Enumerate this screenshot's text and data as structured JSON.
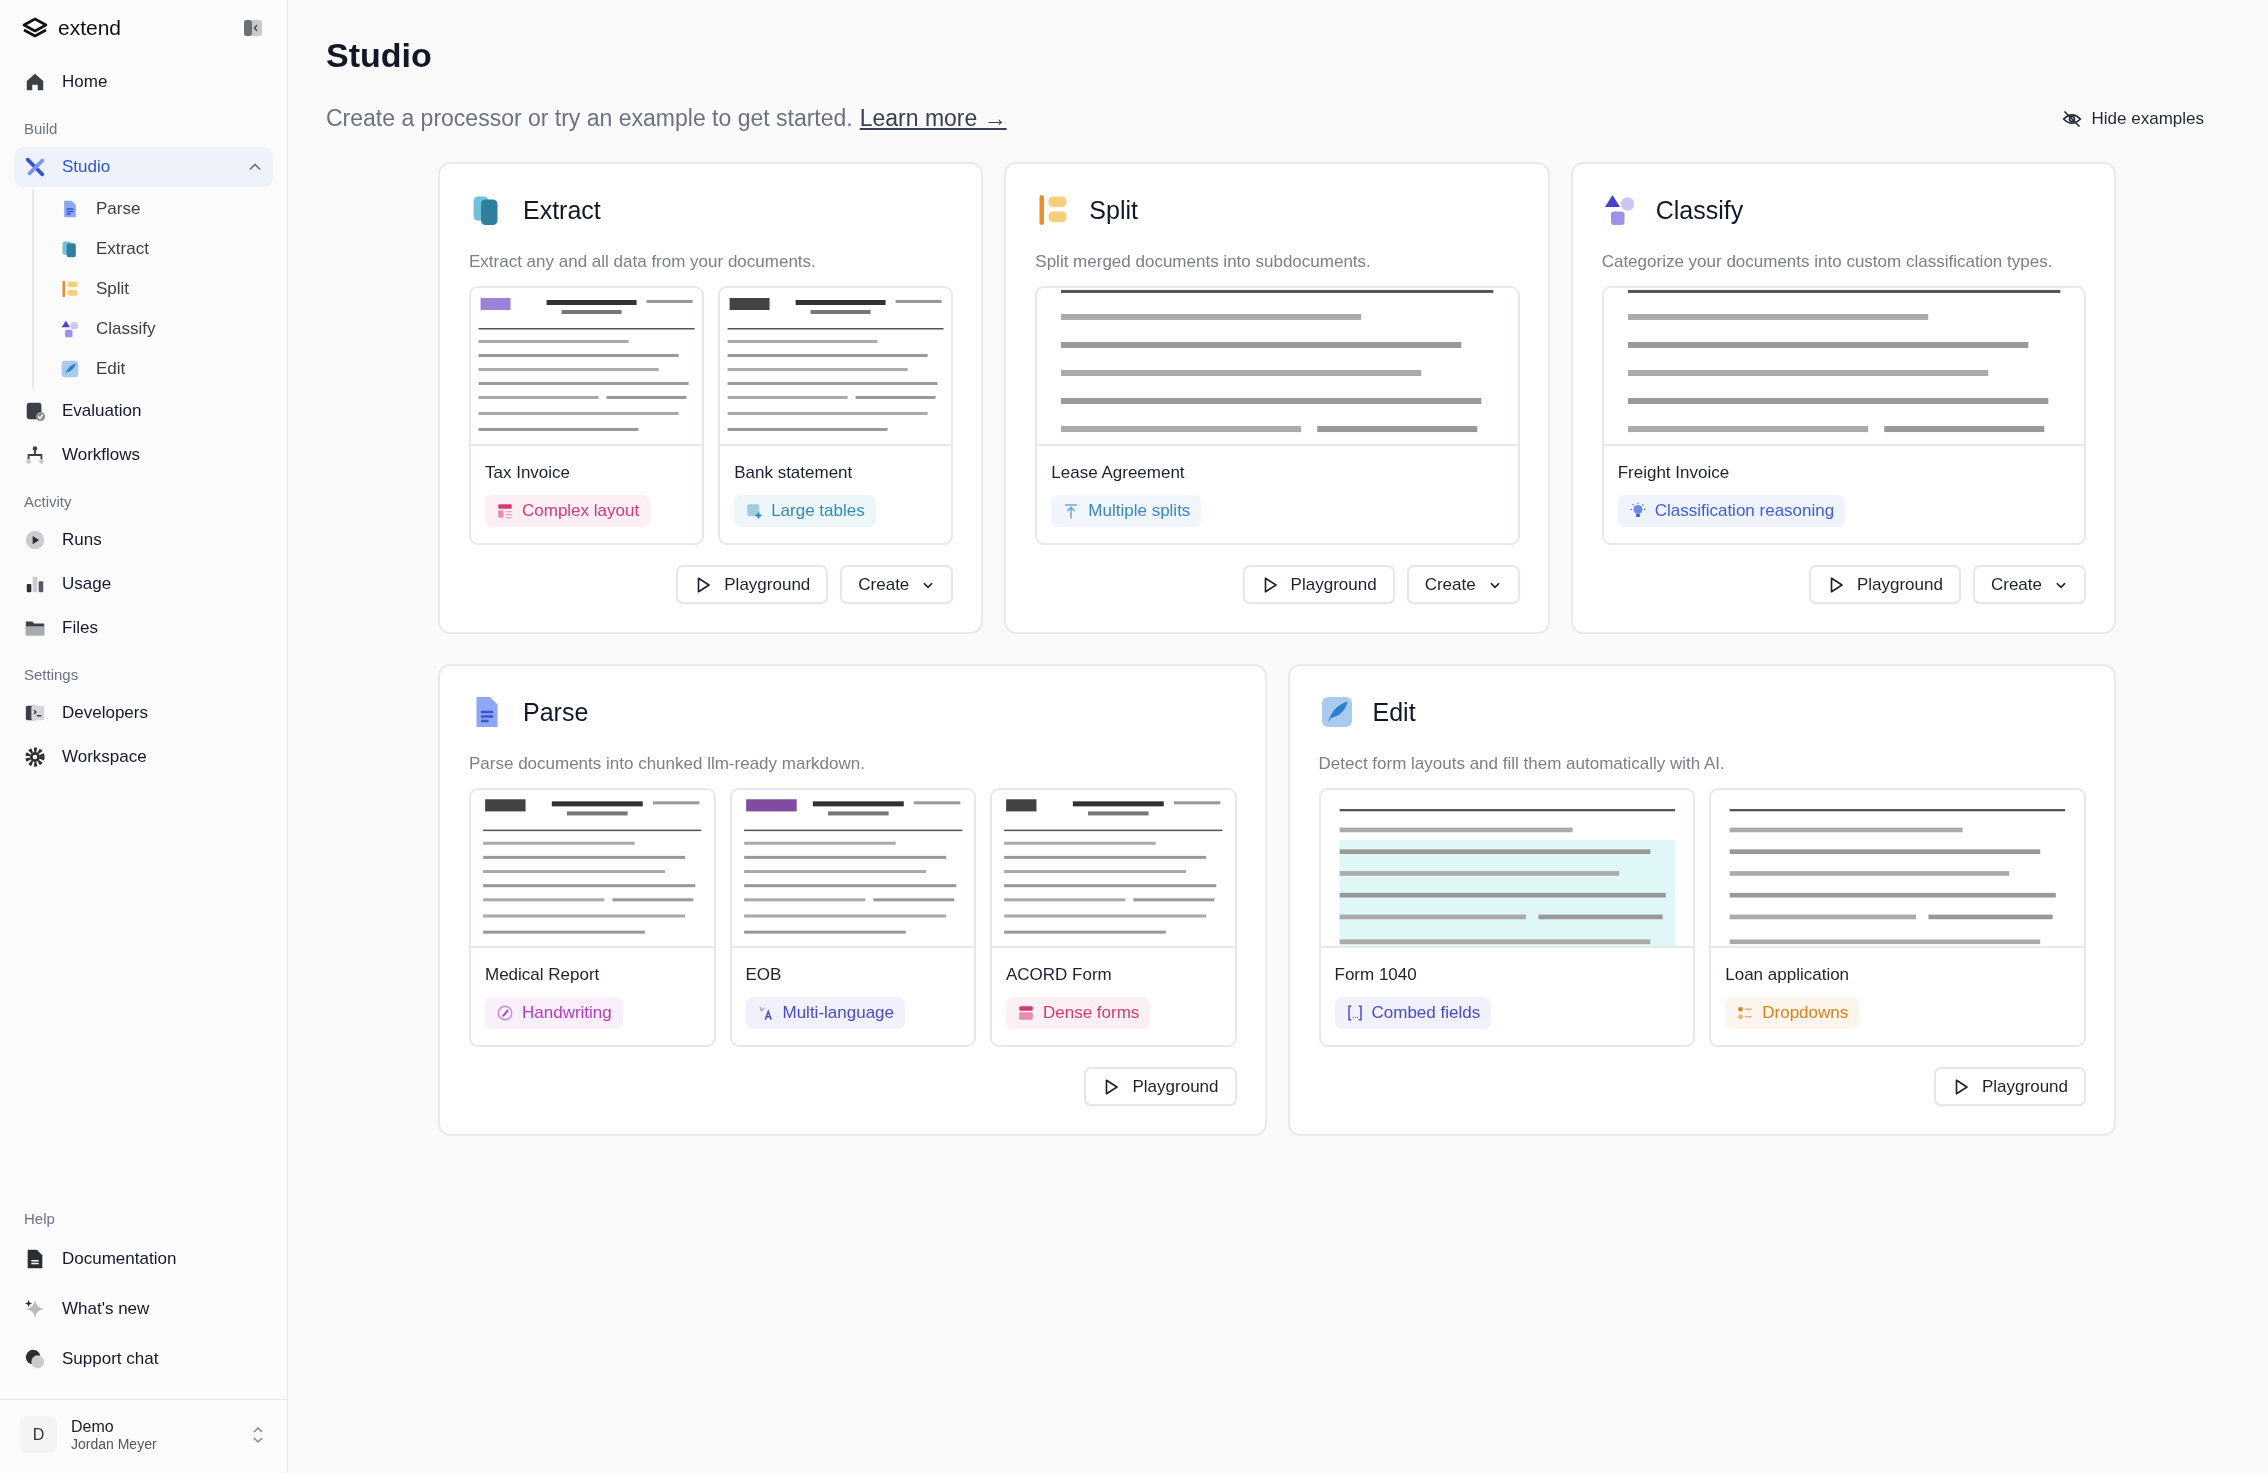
{
  "sidebar": {
    "brand": "extend",
    "sections": [
      {
        "items": [
          {
            "label": "Home",
            "selected": false
          }
        ]
      },
      {
        "label": "Build",
        "items": [
          {
            "label": "Studio",
            "selected": true,
            "expanded": true,
            "children": [
              {
                "label": "Parse",
                "selected": false
              },
              {
                "label": "Extract",
                "selected": false
              },
              {
                "label": "Split",
                "selected": false
              },
              {
                "label": "Classify",
                "selected": false
              },
              {
                "label": "Edit",
                "selected": false
              }
            ]
          },
          {
            "label": "Evaluation",
            "selected": false
          },
          {
            "label": "Workflows",
            "selected": false
          }
        ]
      },
      {
        "label": "Activity",
        "items": [
          {
            "label": "Runs",
            "selected": false
          },
          {
            "label": "Usage",
            "selected": false
          },
          {
            "label": "Files",
            "selected": false
          }
        ]
      },
      {
        "label": "Settings",
        "items": [
          {
            "label": "Developers",
            "selected": false
          },
          {
            "label": "Workspace",
            "selected": false
          }
        ]
      }
    ],
    "help": {
      "label": "Help",
      "items": [
        {
          "label": "Documentation",
          "selected": false
        },
        {
          "label": "What's new",
          "selected": false
        },
        {
          "label": "Support chat",
          "selected": false
        }
      ]
    },
    "account": {
      "initial": "D",
      "workspace": "Demo",
      "user": "Jordan Meyer"
    }
  },
  "page": {
    "title": "Studio",
    "intro": "Create a processor or try an example to get started.",
    "link": "Learn more →",
    "hide_button": "Hide examples"
  },
  "rows": [
    [
      {
        "title": "Extract",
        "description": "Extract any and all data from your documents.",
        "samples": [
          {
            "name": "Tax Invoice",
            "tag": "Complex layout",
            "color": "#d63a74"
          },
          {
            "name": "Bank statement",
            "tag": "Large tables",
            "color": "#2e8fb4"
          }
        ],
        "buttons": [
          {
            "label": "Playground",
            "kind": "play"
          },
          {
            "label": "Create",
            "kind": "menu"
          }
        ]
      },
      {
        "title": "Split",
        "description": "Split merged documents into subdocuments.",
        "samples": [
          {
            "name": "Lease Agreement",
            "tag": "Multiple splits",
            "color": "#3a86c8"
          }
        ],
        "buttons": [
          {
            "label": "Playground",
            "kind": "play"
          },
          {
            "label": "Create",
            "kind": "menu"
          }
        ]
      },
      {
        "title": "Classify",
        "description": "Categorize your documents into custom classification types.",
        "samples": [
          {
            "name": "Freight Invoice",
            "tag": "Classification reasoning",
            "color": "#3d5fdb"
          }
        ],
        "buttons": [
          {
            "label": "Playground",
            "kind": "play"
          },
          {
            "label": "Create",
            "kind": "menu"
          }
        ]
      }
    ],
    [
      {
        "title": "Parse",
        "description": "Parse documents into chunked llm-ready markdown.",
        "samples": [
          {
            "name": "Medical Report",
            "tag": "Handwriting",
            "color": "#b53cc8"
          },
          {
            "name": "EOB",
            "tag": "Multi-language",
            "color": "#4c4ac9"
          },
          {
            "name": "ACORD Form",
            "tag": "Dense forms",
            "color": "#d63a74"
          }
        ],
        "buttons": [
          {
            "label": "Playground",
            "kind": "play"
          }
        ]
      },
      {
        "title": "Edit",
        "description": "Detect form layouts and fill them automatically with AI.",
        "samples": [
          {
            "name": "Form 1040",
            "tag": "Combed fields",
            "color": "#4c4ac9"
          },
          {
            "name": "Loan application",
            "tag": "Dropdowns",
            "color": "#d7821b"
          }
        ],
        "buttons": [
          {
            "label": "Playground",
            "kind": "play"
          }
        ]
      }
    ]
  ]
}
